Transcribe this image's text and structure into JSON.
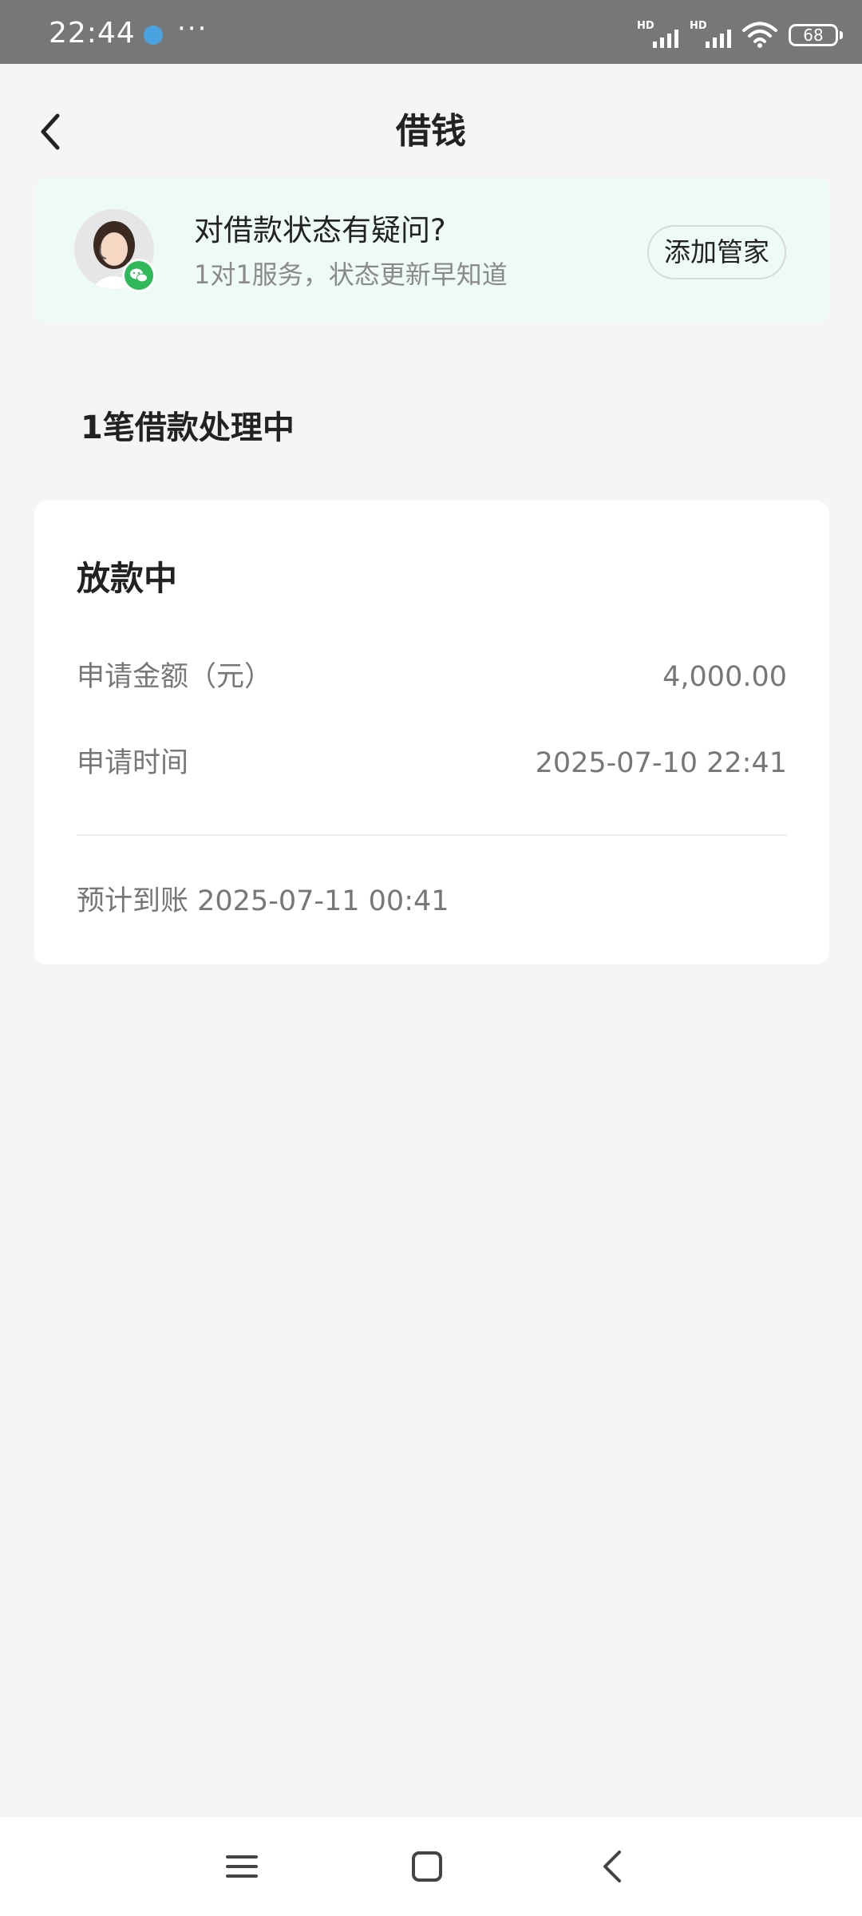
{
  "status_bar": {
    "time": "22:44",
    "more": "···",
    "network_1": "HD",
    "network_2": "HD",
    "battery": "68"
  },
  "header": {
    "title": "借钱",
    "back_icon": "back-chevron-icon"
  },
  "banner": {
    "title": "对借款状态有疑问?",
    "subtitle": "1对1服务，状态更新早知道",
    "button_label": "添加管家",
    "avatar": "customer-service-avatar",
    "badge_icon": "wechat-icon",
    "background_color": "#eefbf4",
    "badge_color": "#2fb95b"
  },
  "section": {
    "title": "1笔借款处理中"
  },
  "loan_card": {
    "status": "放款中",
    "rows": [
      {
        "label": "申请金额（元）",
        "value": "4,000.00"
      },
      {
        "label": "申请时间",
        "value": "2025-07-10 22:41"
      }
    ],
    "arrival": "预计到账 2025-07-11 00:41"
  },
  "nav_bar": {
    "items": [
      "menu-icon",
      "home-square-icon",
      "back-icon"
    ]
  }
}
